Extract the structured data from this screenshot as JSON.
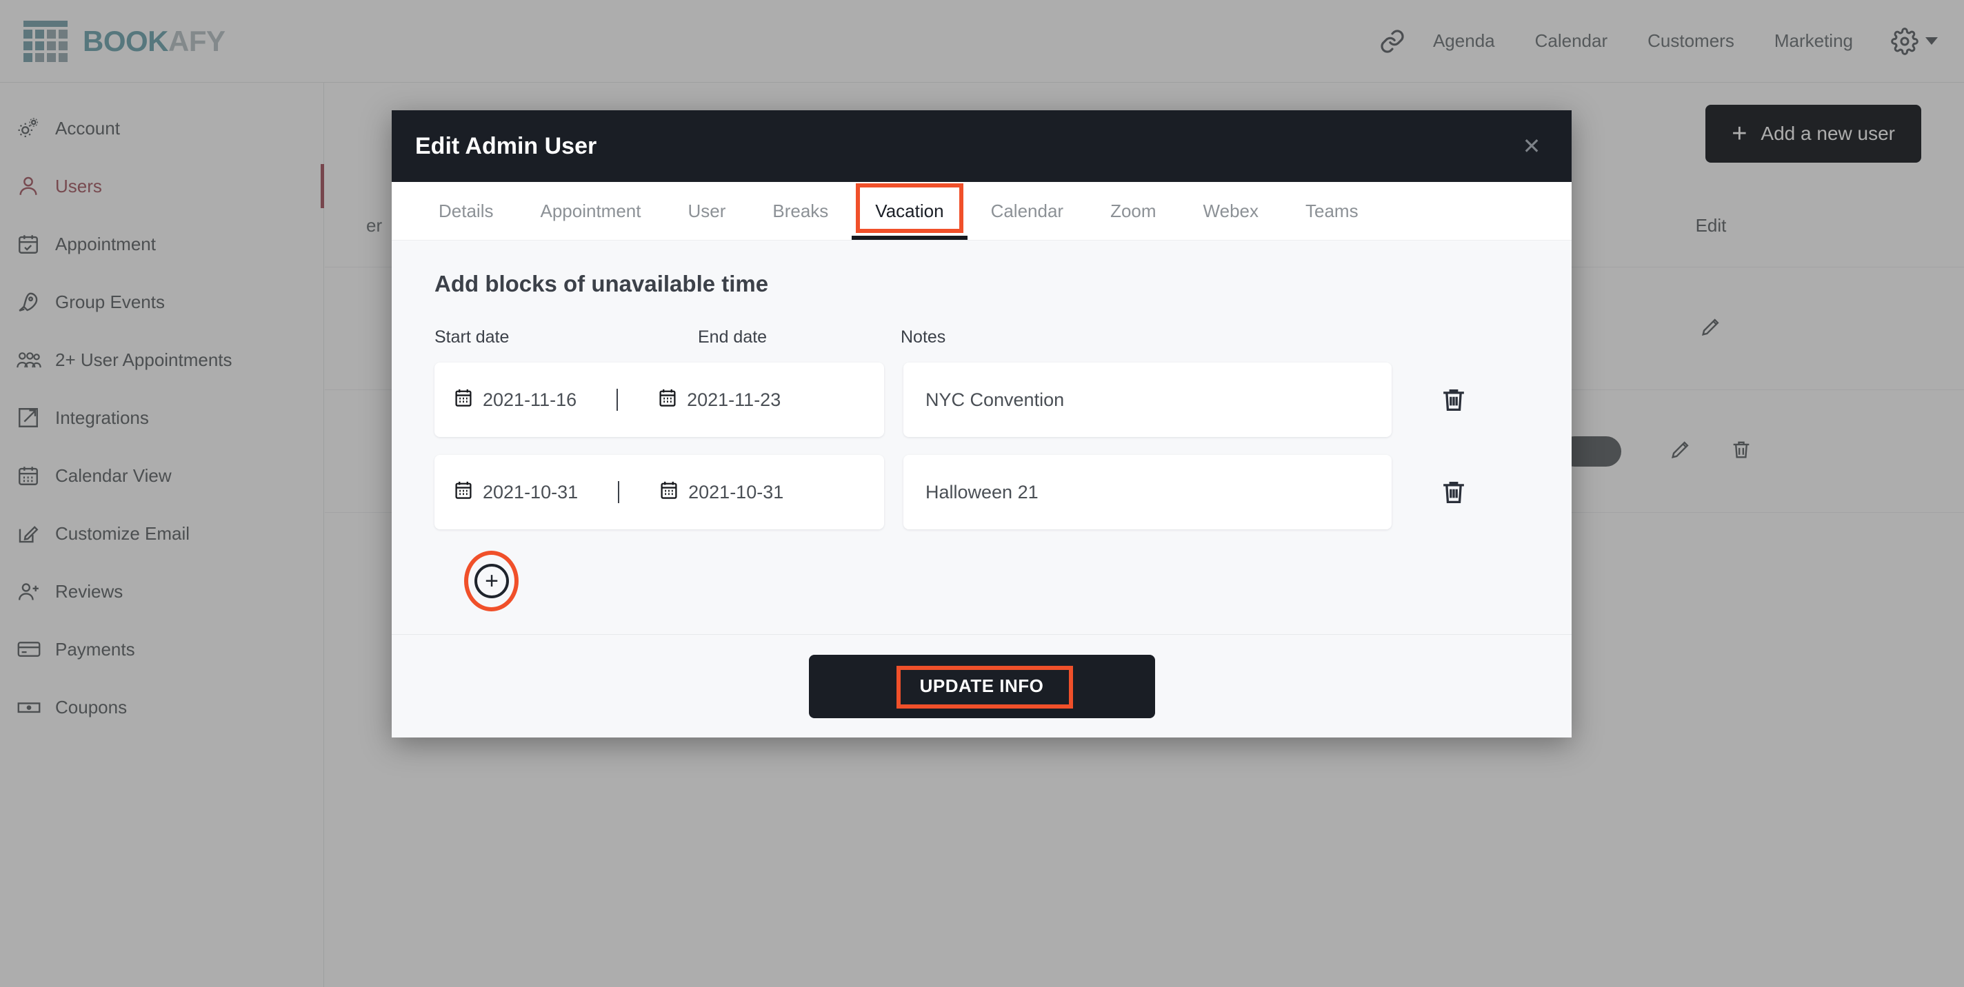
{
  "topbar": {
    "logo_text_primary": "BOOK",
    "logo_text_secondary": "AFY",
    "link_icon": "link-icon",
    "gear_icon": "gear-icon",
    "nav_items": [
      {
        "label": "Agenda"
      },
      {
        "label": "Calendar"
      },
      {
        "label": "Customers"
      },
      {
        "label": "Marketing"
      }
    ]
  },
  "sidebar": {
    "items": [
      {
        "label": "Account",
        "icon": "gears-icon",
        "active": false
      },
      {
        "label": "Users",
        "icon": "user-icon",
        "active": true
      },
      {
        "label": "Appointment",
        "icon": "calendar-check-icon",
        "active": false
      },
      {
        "label": "Group Events",
        "icon": "rocket-icon",
        "active": false
      },
      {
        "label": "2+ User Appointments",
        "icon": "users-group-icon",
        "active": false
      },
      {
        "label": "Integrations",
        "icon": "external-link-icon",
        "active": false
      },
      {
        "label": "Calendar View",
        "icon": "calendar-icon",
        "active": false
      },
      {
        "label": "Customize Email",
        "icon": "pencil-square-icon",
        "active": false
      },
      {
        "label": "Reviews",
        "icon": "user-plus-icon",
        "active": false
      },
      {
        "label": "Payments",
        "icon": "credit-card-icon",
        "active": false
      },
      {
        "label": "Coupons",
        "icon": "banknote-icon",
        "active": false
      }
    ]
  },
  "background_page": {
    "add_user_button": "Add a new user",
    "add_user_icon": "plus-icon",
    "table": {
      "headers": {
        "user_col": "er",
        "edit_col": "Edit"
      },
      "rows": [
        {
          "edit_icon": "pencil-icon",
          "delete_icon": "trash-icon",
          "has_delete": false,
          "has_toggle": false
        },
        {
          "edit_icon": "pencil-icon",
          "delete_icon": "trash-icon",
          "has_delete": true,
          "has_toggle": true
        }
      ]
    }
  },
  "modal": {
    "title": "Edit Admin User",
    "close_icon": "close-icon",
    "tabs": [
      {
        "label": "Details",
        "active": false
      },
      {
        "label": "Appointment",
        "active": false
      },
      {
        "label": "User",
        "active": false
      },
      {
        "label": "Breaks",
        "active": false
      },
      {
        "label": "Vacation",
        "active": true
      },
      {
        "label": "Calendar",
        "active": false
      },
      {
        "label": "Zoom",
        "active": false
      },
      {
        "label": "Webex",
        "active": false
      },
      {
        "label": "Teams",
        "active": false
      }
    ],
    "section_heading": "Add blocks of unavailable time",
    "column_headers": {
      "start_date": "Start date",
      "end_date": "End date",
      "notes": "Notes"
    },
    "rows": [
      {
        "start_date": "2021-11-16",
        "end_date": "2021-11-23",
        "notes": "NYC Convention",
        "start_icon": "calendar-icon",
        "end_icon": "calendar-icon",
        "delete_icon": "trash-icon",
        "separator": "|"
      },
      {
        "start_date": "2021-10-31",
        "end_date": "2021-10-31",
        "notes": "Halloween 21",
        "start_icon": "calendar-icon",
        "end_icon": "calendar-icon",
        "delete_icon": "trash-icon",
        "separator": "|"
      }
    ],
    "add_row_icon": "plus-circle-icon",
    "add_row_glyph": "+",
    "update_button": "UPDATE INFO"
  },
  "annotations": {
    "highlight_color": "#f0502a",
    "targets": [
      "Vacation",
      "add-row-button",
      "UPDATE INFO"
    ]
  },
  "colors": {
    "modal_header_bg": "#1a1e25",
    "modal_body_bg": "#f7f8fa",
    "active_sidebar": "#a6545f",
    "brand_teal": "#6fa5b0",
    "highlight": "#f0502a"
  }
}
